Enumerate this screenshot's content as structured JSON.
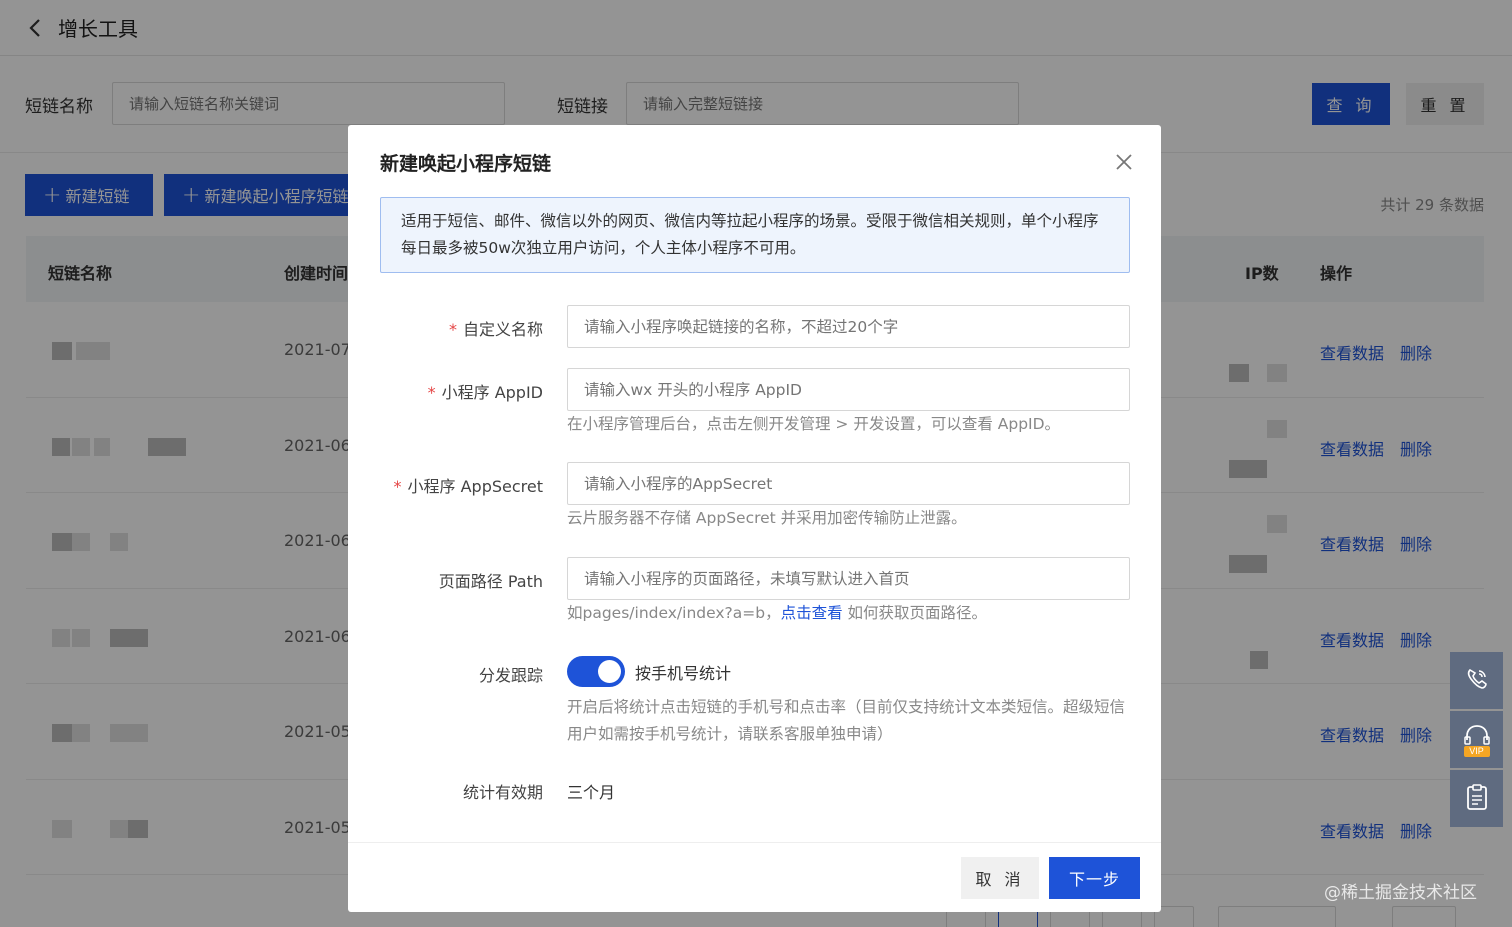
{
  "header": {
    "title": "增长工具"
  },
  "filters": {
    "name_label": "短链名称",
    "name_placeholder": "请输入短链名称关键词",
    "link_label": "短链接",
    "link_placeholder": "请输入完整短链接",
    "query_label": "查 询",
    "reset_label": "重 置"
  },
  "actions": {
    "new_short_link": "新建短链",
    "new_miniapp_link": "新建唤起小程序短链",
    "total_text": "共计 29 条数据"
  },
  "table": {
    "columns": {
      "name": "短链名称",
      "created": "创建时间",
      "ip": "IP数",
      "ops": "操作"
    },
    "rows": [
      {
        "date": "2021-07",
        "view": "查看数据",
        "delete": "删除"
      },
      {
        "date": "2021-06",
        "view": "查看数据",
        "delete": "删除"
      },
      {
        "date": "2021-06",
        "view": "查看数据",
        "delete": "删除"
      },
      {
        "date": "2021-06",
        "view": "查看数据",
        "delete": "删除"
      },
      {
        "date": "2021-05",
        "view": "查看数据",
        "delete": "删除"
      },
      {
        "date": "2021-05",
        "view": "查看数据",
        "delete": "删除"
      }
    ]
  },
  "modal": {
    "title": "新建唤起小程序短链",
    "info": "适用于短信、邮件、微信以外的网页、微信内等拉起小程序的场景。受限于微信相关规则，单个小程序每日最多被50w次独立用户访问，个人主体小程序不可用。",
    "required_mark": "*",
    "fields": {
      "custom_name": {
        "label": "自定义名称",
        "placeholder": "请输入小程序唤起链接的名称，不超过20个字"
      },
      "appid": {
        "label": "小程序 AppID",
        "placeholder": "请输入wx 开头的小程序 AppID",
        "hint": "在小程序管理后台，点击左侧开发管理 > 开发设置，可以查看 AppID。"
      },
      "appsecret": {
        "label": "小程序 AppSecret",
        "placeholder": "请输入小程序的AppSecret",
        "hint": "云片服务器不存储 AppSecret 并采用加密传输防止泄露。"
      },
      "path": {
        "label": "页面路径 Path",
        "placeholder": "请输入小程序的页面路径，未填写默认进入首页",
        "hint_prefix": "如pages/index/index?a=b，",
        "hint_link": "点击查看",
        "hint_suffix": " 如何获取页面路径。"
      },
      "tracking": {
        "label": "分发跟踪",
        "toggle_label": "按手机号统计",
        "toggle_on": true,
        "hint": "开启后将统计点击短链的手机号和点击率（目前仅支持统计文本类短信。超级短信用户如需按手机号统计，请联系客服单独申请）"
      },
      "validity": {
        "label": "统计有效期",
        "value": "三个月"
      }
    },
    "cancel_label": "取 消",
    "next_label": "下一步"
  },
  "float_bar": {
    "icons": [
      "phone-icon",
      "vip-headset-icon",
      "clipboard-icon"
    ],
    "vip_badge": "VIP"
  },
  "watermark": "@稀土掘金技术社区",
  "colors": {
    "primary": "#1e53d8",
    "required": "#e54545",
    "info_bg": "#eef4fd",
    "info_border": "#9fbdf0"
  }
}
